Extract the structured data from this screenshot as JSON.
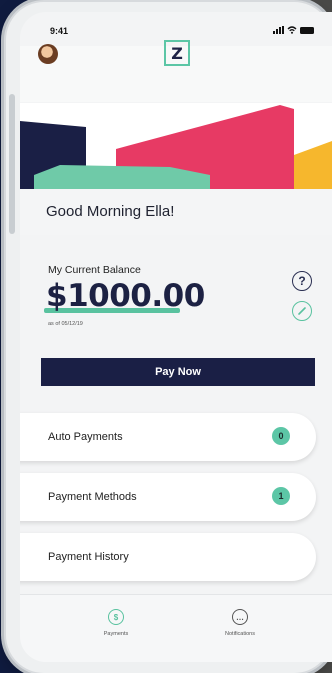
{
  "status_bar": {
    "time": "9:41"
  },
  "header": {
    "logo_letter": "Z"
  },
  "greeting": "Good Morning Ella!",
  "balance": {
    "label": "My Current Balance",
    "amount": "$1000.00",
    "as_of": "as of 05/12/19",
    "help_symbol": "?"
  },
  "pay_button": "Pay Now",
  "menu": [
    {
      "label": "Auto Payments",
      "badge": "0"
    },
    {
      "label": "Payment Methods",
      "badge": "1"
    },
    {
      "label": "Payment History"
    }
  ],
  "tabs": [
    {
      "label": "Payments",
      "icon": "dollar-icon",
      "symbol": "$"
    },
    {
      "label": "Notifications",
      "icon": "chat-bubble-icon",
      "symbol": "…"
    }
  ],
  "colors": {
    "navy": "#1a1f45",
    "mint": "#5cc6a6",
    "pink": "#e73a64",
    "yellow": "#f6b72d",
    "page_bg_left": "#0f1b3f",
    "page_bg_right": "#4a4a48"
  }
}
